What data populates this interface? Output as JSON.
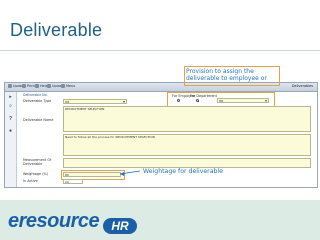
{
  "slide": {
    "title": "Deliverable",
    "callouts": {
      "assign": "Provision to assign the deliverable to employee or Department",
      "weightage": "Weightage for deliverable"
    }
  },
  "app": {
    "toolbar": [
      "Update",
      "Print",
      "Help",
      "Upload",
      "Menu"
    ],
    "toolbar_right": "Deliverables",
    "sidebar_icons": [
      "arrow-icon",
      "search-icon",
      "help-icon",
      "user-icon"
    ],
    "form": {
      "section_title": "Deliverable No.",
      "deliverable_type": {
        "label": "Deliverable Type",
        "value": "HR"
      },
      "for_employee": {
        "label": "For Employee"
      },
      "for_department": {
        "label": "For Department"
      },
      "department": {
        "value": "HR"
      },
      "deliverable_name": {
        "label": "Deliverable Name",
        "value": "RECRUITMENT SELECTION"
      },
      "description": {
        "value": "Need to follow all the process for RECRUITMENT SELECTION"
      },
      "measurement": {
        "label": "Measurement Of Deliverable",
        "value": ""
      },
      "weightage": {
        "label": "Weightage (%)",
        "value": "80"
      },
      "in_active": {
        "label": "In Active",
        "value": "20"
      }
    }
  },
  "brand": {
    "logo_prefix": "eresource",
    "logo_badge": "HR",
    "colors": {
      "blue": "#1b5fa8",
      "orange": "#e7931c"
    }
  }
}
